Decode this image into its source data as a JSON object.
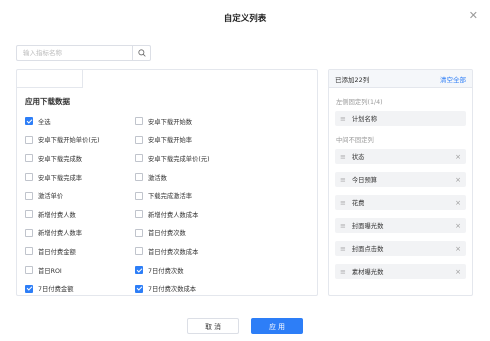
{
  "dialog": {
    "title": "自定义列表"
  },
  "search": {
    "placeholder": "输入指标名称"
  },
  "left": {
    "section_title": "应用下载数据",
    "options": [
      {
        "label": "全选",
        "checked": true
      },
      {
        "label": "安卓下载开始数",
        "checked": false
      },
      {
        "label": "安卓下载开始单价(元)",
        "checked": false
      },
      {
        "label": "安卓下载开始率",
        "checked": false
      },
      {
        "label": "安卓下载完成数",
        "checked": false
      },
      {
        "label": "安卓下载完成单价(元)",
        "checked": false
      },
      {
        "label": "安卓下载完成率",
        "checked": false
      },
      {
        "label": "激活数",
        "checked": false
      },
      {
        "label": "激活单价",
        "checked": false
      },
      {
        "label": "下载完成激活率",
        "checked": false
      },
      {
        "label": "新增付费人数",
        "checked": false
      },
      {
        "label": "新增付费人数成本",
        "checked": false
      },
      {
        "label": "新增付费人数率",
        "checked": false
      },
      {
        "label": "首日付费次数",
        "checked": false
      },
      {
        "label": "首日付费金额",
        "checked": false
      },
      {
        "label": "首日付费次数成本",
        "checked": false
      },
      {
        "label": "首日ROI",
        "checked": false
      },
      {
        "label": "7日付费次数",
        "checked": true
      },
      {
        "label": "7日付费金额",
        "checked": true
      },
      {
        "label": "7日付费次数成本",
        "checked": true
      }
    ]
  },
  "right": {
    "added": "已添加22列",
    "clear_all": "清空全部",
    "fixed_label": "左侧固定列(1/4)",
    "fixed_items": [
      {
        "label": "计划名称"
      }
    ],
    "middle_label": "中间不固定列",
    "middle_items": [
      {
        "label": "状态"
      },
      {
        "label": "今日预算"
      },
      {
        "label": "花费"
      },
      {
        "label": "封面曝光数"
      },
      {
        "label": "封面点击数"
      },
      {
        "label": "素材曝光数"
      }
    ]
  },
  "footer": {
    "cancel": "取 消",
    "apply": "应 用"
  },
  "icons": {
    "close": "close-icon",
    "search": "search-icon",
    "drag": "drag-handle-icon",
    "remove": "remove-icon"
  },
  "colors": {
    "primary": "#2d7ef7"
  }
}
